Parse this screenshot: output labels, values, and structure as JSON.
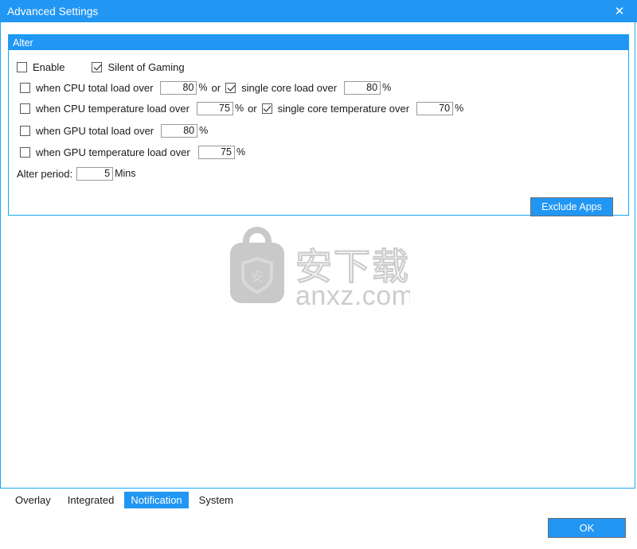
{
  "window": {
    "title": "Advanced Settings",
    "close_icon": "close-icon",
    "close_glyph": "✕"
  },
  "colors": {
    "accent": "#2196f3",
    "panel_border": "#19a6ef",
    "field_border": "#9a9a9a",
    "button_border": "#6d6d6d",
    "text": "#1a1a1a",
    "watermark": "#c9c9c9"
  },
  "group": {
    "header": "Alter",
    "enable": {
      "label": "Enable",
      "checked": false
    },
    "silent_of_gaming": {
      "label": "Silent of Gaming",
      "checked": true
    },
    "rules": [
      {
        "id": "cpu-total-load",
        "checkbox_label": "when CPU total load over",
        "checked": false,
        "value": "80",
        "unit": "%",
        "conjunction": "or",
        "second": {
          "id": "cpu-single-core-load",
          "checkbox_label": "single core load over",
          "checked": true,
          "value": "80",
          "unit": "%"
        }
      },
      {
        "id": "cpu-temperature-load",
        "checkbox_label": "when CPU temperature load over",
        "checked": false,
        "value": "75",
        "unit": "%",
        "conjunction": "or",
        "second": {
          "id": "cpu-single-core-temperature",
          "checkbox_label": "single core temperature over",
          "checked": true,
          "value": "70",
          "unit": "%"
        }
      },
      {
        "id": "gpu-total-load",
        "checkbox_label": "when GPU total load over",
        "checked": false,
        "value": "80",
        "unit": "%"
      },
      {
        "id": "gpu-temperature-load",
        "checkbox_label": "when GPU temperature load over",
        "checked": false,
        "value": "75",
        "unit": "%"
      }
    ],
    "alter_period": {
      "label": "Alter period:",
      "value": "5",
      "unit": "Mins"
    },
    "exclude_apps_button": "Exclude Apps"
  },
  "watermark": {
    "text": "anxz.com",
    "cn_chars": "安下载",
    "badge_char": "安"
  },
  "tabs": [
    {
      "label": "Overlay",
      "active": false
    },
    {
      "label": "Integrated",
      "active": false
    },
    {
      "label": "Notification",
      "active": true
    },
    {
      "label": "System",
      "active": false
    }
  ],
  "footer": {
    "ok_label": "OK"
  }
}
